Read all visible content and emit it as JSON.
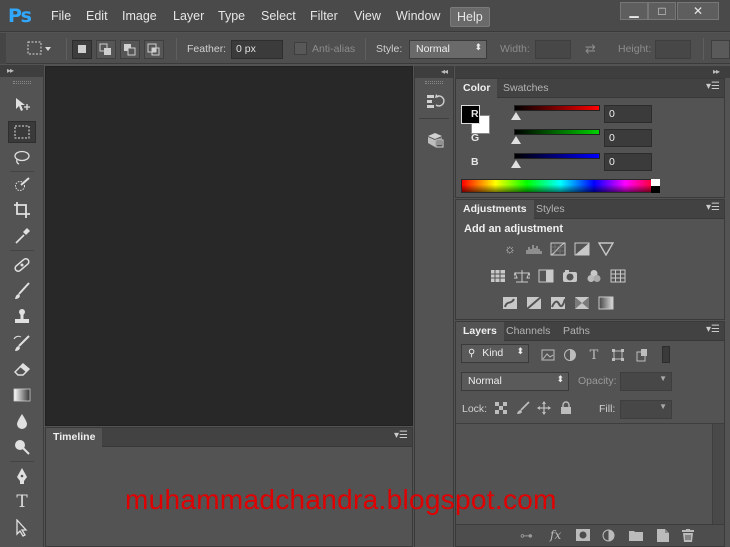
{
  "app": {
    "logo": "Ps"
  },
  "menu": [
    "File",
    "Edit",
    "Image",
    "Layer",
    "Type",
    "Select",
    "Filter",
    "View",
    "Window",
    "Help"
  ],
  "window_controls": {
    "minimize": "▁",
    "maximize": "□",
    "close": "✕"
  },
  "options_bar": {
    "feather_label": "Feather:",
    "feather_value": "0 px",
    "antialias_label": "Anti-alias",
    "style_label": "Style:",
    "style_value": "Normal",
    "width_label": "Width:",
    "height_label": "Height:",
    "swap_icon": "⇄"
  },
  "tools": [
    {
      "name": "move-tool",
      "glyph": "✥"
    },
    {
      "name": "marquee-tool",
      "glyph": "⬚"
    },
    {
      "name": "lasso-tool",
      "glyph": "◯"
    },
    {
      "name": "quick-selection-tool",
      "glyph": "✎"
    },
    {
      "name": "crop-tool",
      "glyph": "⌗"
    },
    {
      "name": "eyedropper-tool",
      "glyph": "✒"
    },
    {
      "name": "healing-brush-tool",
      "glyph": "✚"
    },
    {
      "name": "brush-tool",
      "glyph": "🖌"
    },
    {
      "name": "clone-stamp-tool",
      "glyph": "♣"
    },
    {
      "name": "history-brush-tool",
      "glyph": "✐"
    },
    {
      "name": "eraser-tool",
      "glyph": "▰"
    },
    {
      "name": "gradient-tool",
      "glyph": "■"
    },
    {
      "name": "blur-tool",
      "glyph": "●"
    },
    {
      "name": "dodge-tool",
      "glyph": "◉"
    },
    {
      "name": "pen-tool",
      "glyph": "✑"
    },
    {
      "name": "type-tool",
      "glyph": "T"
    },
    {
      "name": "path-selection-tool",
      "glyph": "➤"
    }
  ],
  "timeline": {
    "tab": "Timeline"
  },
  "color_panel": {
    "tabs": [
      "Color",
      "Swatches"
    ],
    "channels": [
      {
        "label": "R",
        "value": "0",
        "color": "#ff0000"
      },
      {
        "label": "G",
        "value": "0",
        "color": "#00d000"
      },
      {
        "label": "B",
        "value": "0",
        "color": "#0000ff"
      }
    ],
    "foreground": "#000000",
    "background": "#ffffff"
  },
  "adjustments_panel": {
    "tabs": [
      "Adjustments",
      "Styles"
    ],
    "heading": "Add an adjustment"
  },
  "layers_panel": {
    "tabs": [
      "Layers",
      "Channels",
      "Paths"
    ],
    "kind_label": "Kind",
    "blend_mode": "Normal",
    "opacity_label": "Opacity:",
    "lock_label": "Lock:",
    "fill_label": "Fill:"
  },
  "watermark": "muhammadchandra.blogspot.com"
}
